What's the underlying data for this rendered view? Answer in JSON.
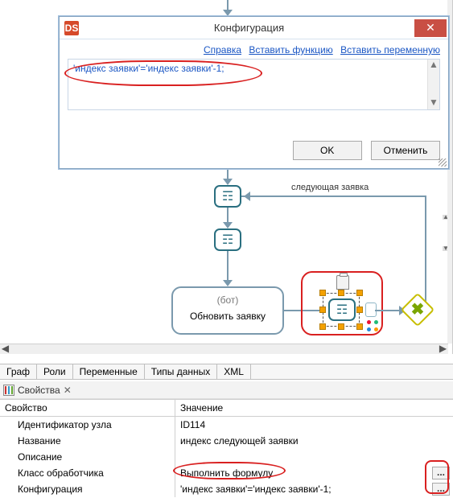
{
  "dialog": {
    "title": "Конфигурация",
    "icon_text": "DS",
    "links": {
      "help": "Справка",
      "insert_fn": "Вставить функцию",
      "insert_var": "Вставить переменную"
    },
    "formula": "'индекс заявки'='индекс заявки'-1;",
    "ok": "OK",
    "cancel": "Отменить"
  },
  "edge_label": "следующая заявка",
  "task": {
    "role": "(бот)",
    "title": "Обновить заявку"
  },
  "tabs": [
    "Граф",
    "Роли",
    "Переменные",
    "Типы данных",
    "XML"
  ],
  "props_panel": {
    "title": "Свойства"
  },
  "props_header": {
    "name": "Свойство",
    "value": "Значение"
  },
  "props": [
    {
      "name": "Идентификатор узла",
      "value": "ID114"
    },
    {
      "name": "Название",
      "value": "индекс следующей заявки"
    },
    {
      "name": "Описание",
      "value": ""
    },
    {
      "name": "Класс обработчика",
      "value": "Выполнить формулу"
    },
    {
      "name": "Конфигурация",
      "value": "'индекс заявки'='индекс заявки'-1;"
    }
  ]
}
